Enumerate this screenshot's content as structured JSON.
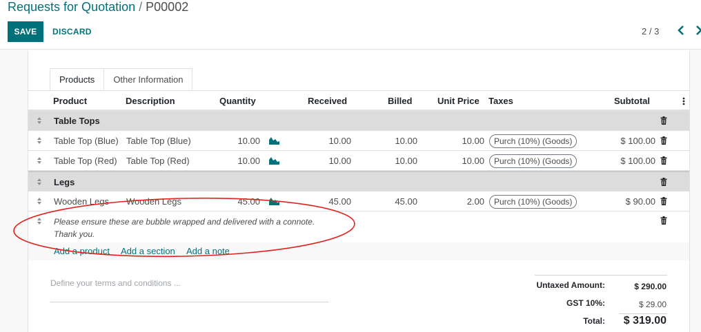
{
  "breadcrumb": {
    "parent": "Requests for Quotation",
    "separator": "/",
    "current": "P00002"
  },
  "actions": {
    "save_label": "SAVE",
    "discard_label": "DISCARD"
  },
  "pager": {
    "text": "2 / 3"
  },
  "tabs": [
    {
      "label": "Products",
      "active": true
    },
    {
      "label": "Other Information",
      "active": false
    }
  ],
  "columns": {
    "product": "Product",
    "description": "Description",
    "quantity": "Quantity",
    "received": "Received",
    "billed": "Billed",
    "unit_price": "Unit Price",
    "taxes": "Taxes",
    "subtotal": "Subtotal"
  },
  "lines": {
    "section_1": "Table Tops",
    "row_1": {
      "product": "Table Top (Blue)",
      "description": "Table Top (Blue)",
      "quantity": "10.00",
      "received": "10.00",
      "billed": "10.00",
      "unit_price": "10.00",
      "tax": "Purch (10%) (Goods)",
      "subtotal": "$ 100.00"
    },
    "row_2": {
      "product": "Table Top (Red)",
      "description": "Table Top (Red)",
      "quantity": "10.00",
      "received": "10.00",
      "billed": "10.00",
      "unit_price": "10.00",
      "tax": "Purch (10%) (Goods)",
      "subtotal": "$ 100.00"
    },
    "section_2": "Legs",
    "row_3": {
      "product": "Wooden Legs",
      "description": "Wooden Legs",
      "quantity": "45.00",
      "received": "45.00",
      "billed": "45.00",
      "unit_price": "2.00",
      "tax": "Purch (10%) (Goods)",
      "subtotal": "$ 90.00"
    },
    "note": {
      "line1": "Please ensure these are bubble wrapped and delivered with a connote.",
      "line2": "Thank you."
    }
  },
  "add_links": {
    "product": "Add a product",
    "section": "Add a section",
    "note": "Add a note"
  },
  "terms_placeholder": "Define your terms and conditions ...",
  "totals": {
    "untaxed_label": "Untaxed Amount:",
    "untaxed_value": "$ 290.00",
    "gst_label": "GST 10%:",
    "gst_value": "$ 29.00",
    "total_label": "Total:",
    "total_value": "$ 319.00"
  },
  "colors": {
    "accent": "#00717a",
    "section_bg": "#dcdcdc",
    "annotation": "#e0221b"
  }
}
